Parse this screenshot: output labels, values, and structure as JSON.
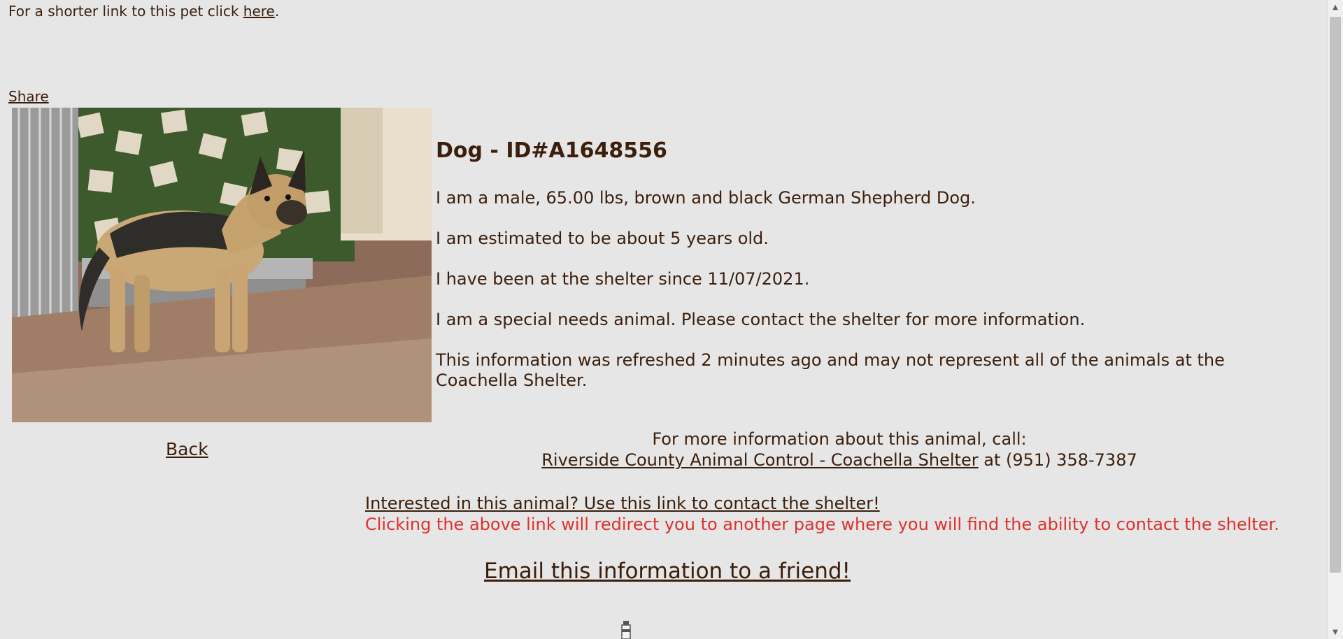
{
  "header": {
    "short_link_prefix": "For a shorter link to this pet click",
    "short_link_label": "here",
    "short_link_suffix": ".",
    "share_label": "Share"
  },
  "pet": {
    "heading": "Dog - ID#A1648556",
    "details": [
      "I am a male, 65.00 lbs, brown and black German Shepherd Dog.",
      "I am estimated to be about 5 years old.",
      "I have been at the shelter since 11/07/2021.",
      "I am a special needs animal. Please contact the shelter for more information.",
      "This information was refreshed 2 minutes ago and may not represent all of the animals at the Coachella Shelter."
    ],
    "photo_icon": "dog-photo"
  },
  "navigation": {
    "back_label": "Back"
  },
  "contact": {
    "intro": "For more information about this animal, call:",
    "shelter_name": "Riverside County Animal Control - Coachella Shelter",
    "phone_prefix": "at",
    "phone": "(951) 358-7387",
    "interest_link": "Interested in this animal? Use this link to contact the shelter!",
    "redirect_warning": "Clicking the above link will redirect you to another page where you will find the ability to contact the shelter.",
    "email_link": "Email this information to a friend!"
  },
  "colors": {
    "background": "#e6e6e6",
    "text": "#3b1f0c",
    "warning": "#e0312b"
  }
}
